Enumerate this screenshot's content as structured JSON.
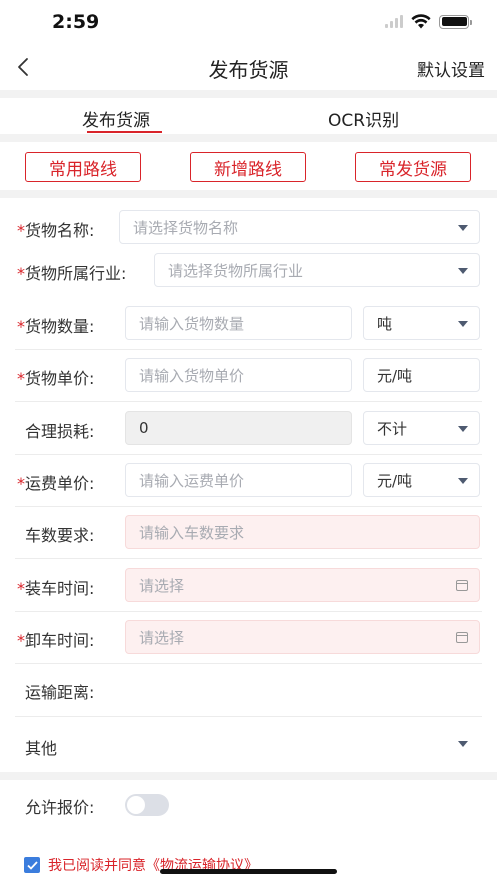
{
  "status_bar": {
    "time": "2:59"
  },
  "navbar": {
    "title": "发布货源",
    "right_action": "默认设置"
  },
  "tabs": [
    {
      "label": "发布货源",
      "active": true
    },
    {
      "label": "OCR识别",
      "active": false
    }
  ],
  "route_buttons": [
    {
      "label": "常用路线"
    },
    {
      "label": "新增路线"
    },
    {
      "label": "常发货源"
    }
  ],
  "form": {
    "required_mark": "*",
    "cargo_name": {
      "label": "货物名称:",
      "placeholder": "请选择货物名称"
    },
    "industry": {
      "label": "货物所属行业:",
      "placeholder": "请选择货物所属行业"
    },
    "quantity": {
      "label": "货物数量:",
      "placeholder": "请输入货物数量",
      "unit": "吨"
    },
    "unit_price": {
      "label": "货物单价:",
      "placeholder": "请输入货物单价",
      "unit": "元/吨"
    },
    "loss": {
      "label": "合理损耗:",
      "value": "0",
      "unit": "不计"
    },
    "freight_price": {
      "label": "运费单价:",
      "placeholder": "请输入运费单价",
      "unit": "元/吨"
    },
    "vehicle_count": {
      "label": "车数要求:",
      "placeholder": "请输入车数要求"
    },
    "load_time": {
      "label": "装车时间:",
      "placeholder": "请选择"
    },
    "unload_time": {
      "label": "卸车时间:",
      "placeholder": "请选择"
    },
    "distance": {
      "label": "运输距离:"
    },
    "other": {
      "label": "其他"
    },
    "allow_quote": {
      "label": "允许报价:",
      "enabled": false
    }
  },
  "agreement": {
    "prefix": "我已阅读并同意",
    "link": "《物流运输协议》",
    "checked": true
  },
  "colors": {
    "accent": "#d9242a",
    "checkbox": "#3b7ddd",
    "section_gap": "#f2f2f2",
    "pink_field": "#fdf0f0"
  }
}
